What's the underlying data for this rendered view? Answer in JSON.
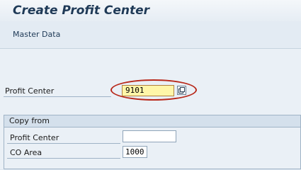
{
  "window": {
    "title": "Create Profit Center"
  },
  "toolbar": {
    "master_data_label": "Master Data"
  },
  "main": {
    "profit_center_label": "Profit Center",
    "profit_center_value": "9101",
    "f4_help_icon": "f4-value-help-icon",
    "highlight_color": "#b8281a"
  },
  "copy_from": {
    "header": "Copy from",
    "profit_center_label": "Profit Center",
    "profit_center_value": "",
    "co_area_label": "CO Area",
    "co_area_value": "1000"
  }
}
